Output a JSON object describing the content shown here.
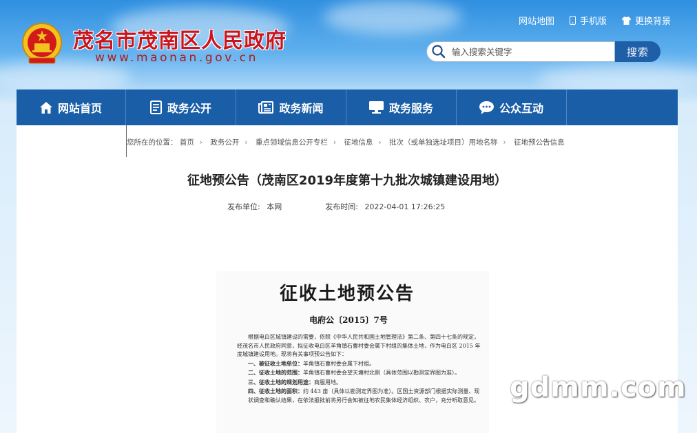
{
  "header": {
    "site_title": "茂名市茂南区人民政府",
    "site_url": "www.maonan.gov.cn",
    "top_links": [
      "网站地图",
      "手机版",
      "更换背景"
    ],
    "search_placeholder": "输入搜索关键字",
    "search_button": "搜索"
  },
  "nav": [
    {
      "label": "网站首页",
      "icon": "home-icon"
    },
    {
      "label": "政务公开",
      "icon": "document-icon"
    },
    {
      "label": "政务新闻",
      "icon": "newspaper-icon"
    },
    {
      "label": "政务服务",
      "icon": "monitor-icon"
    },
    {
      "label": "公众互动",
      "icon": "chat-icon"
    }
  ],
  "breadcrumb": {
    "prefix": "您所在的位置：",
    "items": [
      "首页",
      "政务公开",
      "重点领域信息公开专栏",
      "征地信息",
      "批次（或单独选址项目）用地名称",
      "征地预公告信息"
    ]
  },
  "article": {
    "title": "征地预公告（茂南区2019年度第十九批次城镇建设用地）",
    "publisher_label": "发布单位:",
    "publisher": "本网",
    "time_label": "发布时间:",
    "time": "2022-04-01 17:26:25"
  },
  "scan": {
    "title": "征收土地预公告",
    "doc_number": "电府公〔2015〕7号",
    "para1": "根据电白区城镇建设的需要，依照《中华人民共和国土地管理法》第二条、第四十七条的规定，经茂名市人民政府同意，拟征收电白区羊角镇石曹村委会属下村组的集体土地，作为电白区 2015 年度城镇建设用地。现将有关事项预公告如下：",
    "item1_label": "一、被征收土地单位：",
    "item1": "羊角镇石曹村委会属下村组。",
    "item2_label": "二、征收土地的范围：",
    "item2": "羊角镇石曹村委会望天塘村北侧（具体范围以勘测定界图为准）。",
    "item3_label": "三、征收土地的规划用途：",
    "item3": "商服用地。",
    "item4_label": "四、征收土地的面积：",
    "item4": "约 443 亩（具体以勘测定界图为准）。区国土资源部门根据实际测量、现状调查和确认结果，在依法报批前将另行会知被征地农民集体经济组织、农户，充分听取意见。"
  },
  "watermark": "gdmm.com"
}
